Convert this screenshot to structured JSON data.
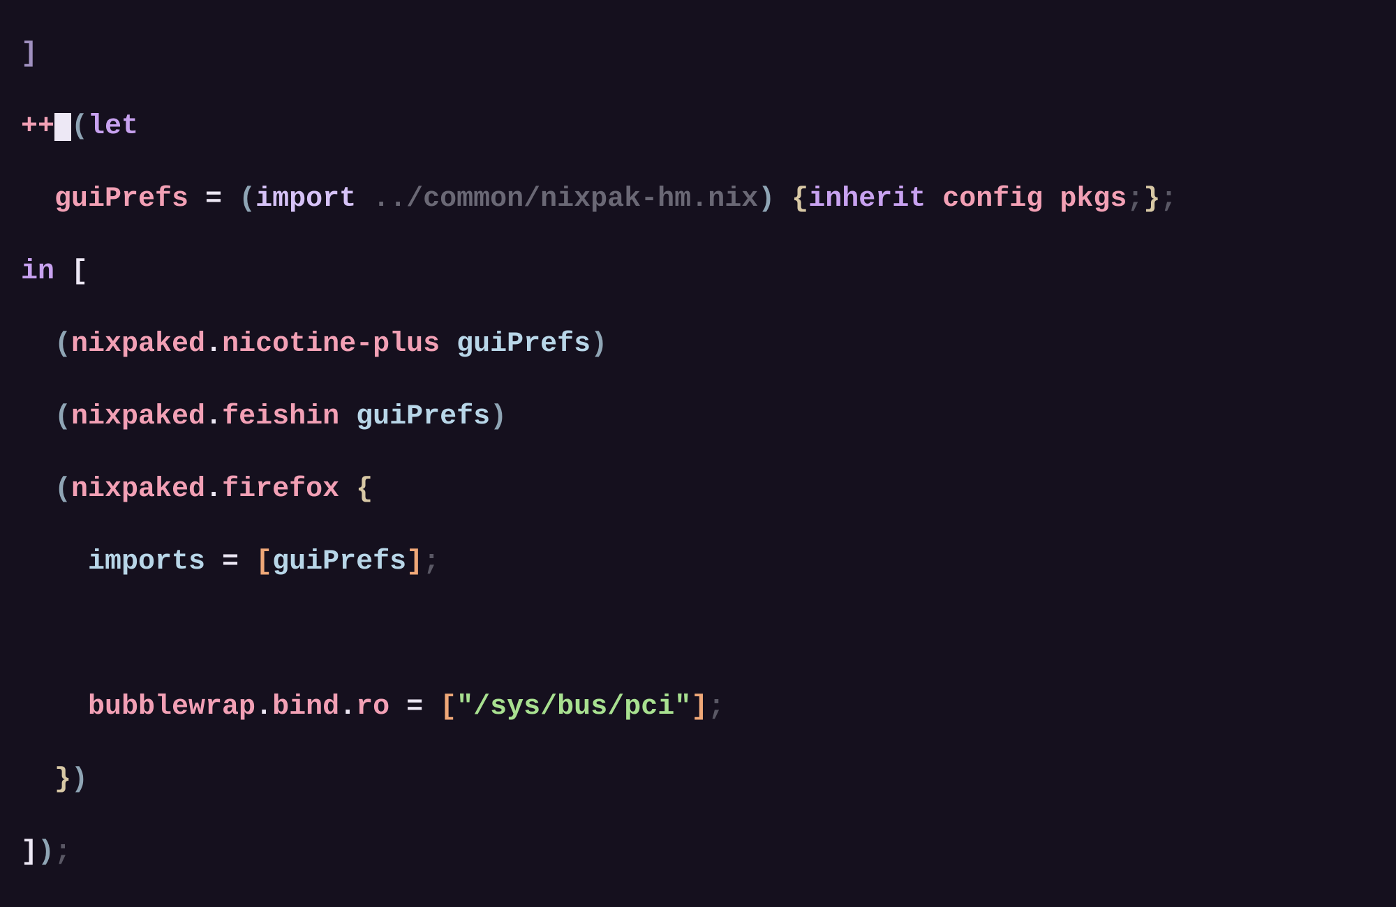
{
  "code": {
    "l0_bracket": "]",
    "l1_plusplus": "++",
    "l1_space": " ",
    "l1_paren": "(",
    "l1_let": "let",
    "l2_indent": "  ",
    "l2_guiPrefs": "guiPrefs",
    "l2_eq": " = ",
    "l2_paren1": "(",
    "l2_import": "import",
    "l2_path": " ../common/nixpak-hm.nix",
    "l2_paren2": ")",
    "l2_space": " ",
    "l2_brace1": "{",
    "l2_inherit": "inherit",
    "l2_config": " config",
    "l2_pkgs": " pkgs",
    "l2_semi1": ";",
    "l2_brace2": "}",
    "l2_semi2": ";",
    "l3_in": "in",
    "l3_bracket": " [",
    "l4_indent": "  ",
    "l4_paren1": "(",
    "l4_nixpaked": "nixpaked",
    "l4_dot": ".",
    "l4_nicotine": "nicotine-plus",
    "l4_space": " ",
    "l4_guiPrefs": "guiPrefs",
    "l4_paren2": ")",
    "l5_indent": "  ",
    "l5_paren1": "(",
    "l5_nixpaked": "nixpaked",
    "l5_dot": ".",
    "l5_feishin": "feishin",
    "l5_space": " ",
    "l5_guiPrefs": "guiPrefs",
    "l5_paren2": ")",
    "l6_indent": "  ",
    "l6_paren1": "(",
    "l6_nixpaked": "nixpaked",
    "l6_dot": ".",
    "l6_firefox": "firefox",
    "l6_space": " ",
    "l6_brace": "{",
    "l7_indent": "    ",
    "l7_imports": "imports",
    "l7_eq": " = ",
    "l7_bracket1": "[",
    "l7_guiPrefs": "guiPrefs",
    "l7_bracket2": "]",
    "l7_semi": ";",
    "l8": "",
    "l9_indent": "    ",
    "l9_bubblewrap": "bubblewrap",
    "l9_dot1": ".",
    "l9_bind": "bind",
    "l9_dot2": ".",
    "l9_ro": "ro",
    "l9_eq": " = ",
    "l9_bracket1": "[",
    "l9_str": "\"/sys/bus/pci\"",
    "l9_bracket2": "]",
    "l9_semi": ";",
    "l10_indent": "  ",
    "l10_brace": "}",
    "l10_paren": ")",
    "l11_bracket": "]",
    "l11_paren": ")",
    "l11_semi": ";"
  }
}
